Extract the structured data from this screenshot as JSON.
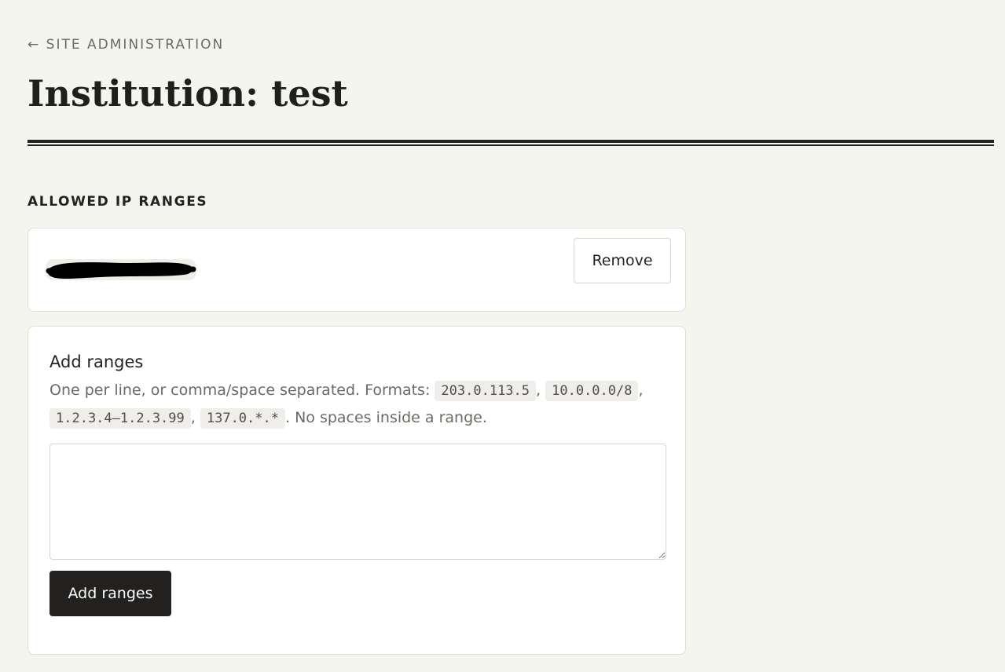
{
  "header": {
    "back_arrow": "←",
    "back_label": "SITE ADMINISTRATION",
    "title": "Institution: test"
  },
  "allowed_ranges": {
    "heading": "ALLOWED IP RANGES",
    "items": [
      {
        "value": "",
        "redacted": true,
        "remove_label": "Remove"
      }
    ]
  },
  "add_form": {
    "title": "Add ranges",
    "help_intro": "One per line, or comma/space separated. Formats:",
    "formats": [
      "203.0.113.5",
      "10.0.0.0/8",
      "1.2.3.4–1.2.3.99",
      "137.0.*.*"
    ],
    "help_outro": ". No spaces inside a range.",
    "input_value": "",
    "input_placeholder": "",
    "submit_label": "Add ranges"
  },
  "colors": {
    "background": "#f5f5f0",
    "card": "#ffffff",
    "text": "#222220",
    "muted": "#6b6a64",
    "primary_button": "#22211f"
  }
}
